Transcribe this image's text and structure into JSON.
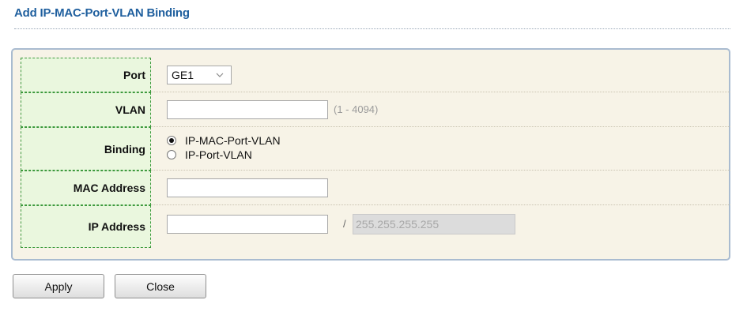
{
  "header": {
    "title": "Add IP-MAC-Port-VLAN Binding"
  },
  "form": {
    "port": {
      "label": "Port",
      "selected": "GE1"
    },
    "vlan": {
      "label": "VLAN",
      "value": "",
      "hint": "(1 - 4094)"
    },
    "binding": {
      "label": "Binding",
      "options": [
        {
          "label": "IP-MAC-Port-VLAN",
          "checked": true
        },
        {
          "label": "IP-Port-VLAN",
          "checked": false
        }
      ]
    },
    "mac": {
      "label": "MAC Address",
      "value": ""
    },
    "ip": {
      "label": "IP Address",
      "value": "",
      "separator": "/",
      "mask": "255.255.255.255"
    }
  },
  "buttons": {
    "apply": "Apply",
    "close": "Close"
  },
  "colors": {
    "title": "#1f5f9e",
    "label_bg": "#eaf7de",
    "panel_bg": "#f7f3e7",
    "panel_border": "#a9bbd0"
  }
}
